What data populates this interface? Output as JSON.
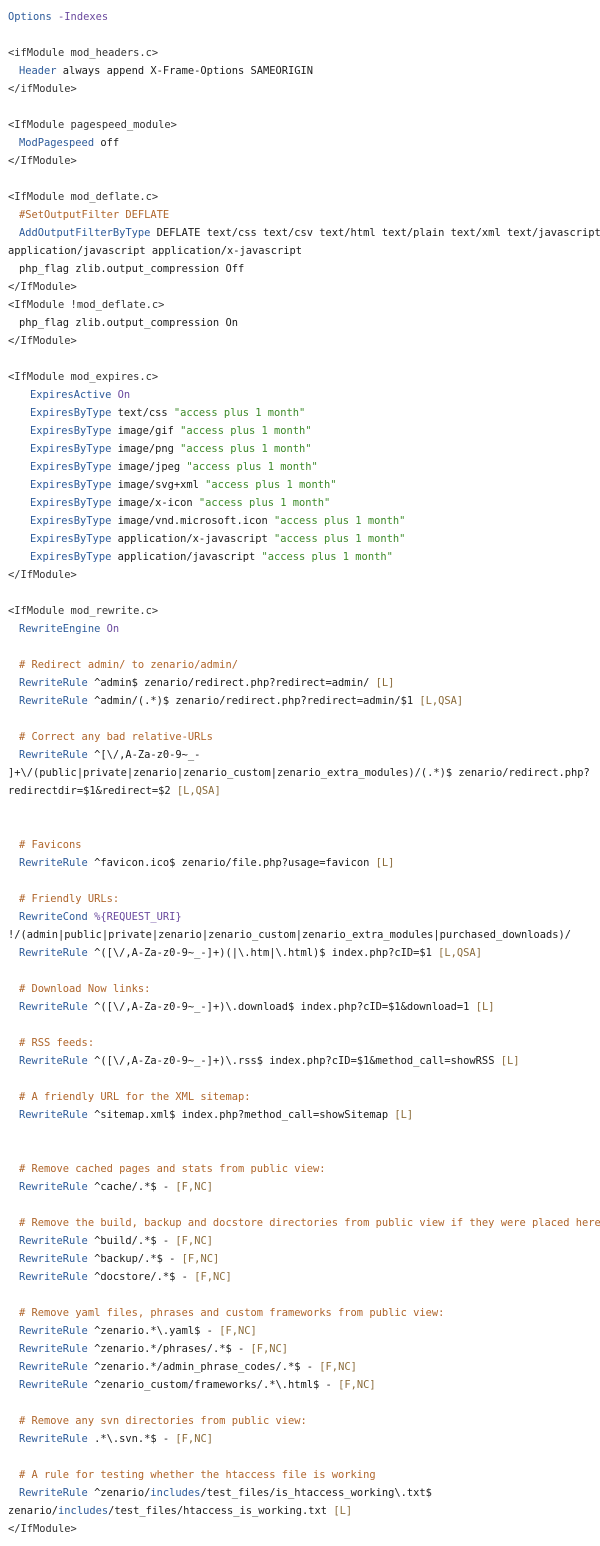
{
  "lines": [
    {
      "indent": 0,
      "parts": [
        [
          "dir",
          "Options "
        ],
        [
          "kw",
          "-Indexes"
        ]
      ]
    },
    {
      "blank": true
    },
    {
      "indent": 0,
      "parts": [
        [
          "tag",
          "<ifModule mod_headers.c>"
        ]
      ]
    },
    {
      "indent": 1,
      "parts": [
        [
          "dir",
          "Header"
        ],
        [
          "val",
          " always append X-Frame-Options SAMEORIGIN"
        ]
      ]
    },
    {
      "indent": 0,
      "parts": [
        [
          "tag",
          "</ifModule>"
        ]
      ]
    },
    {
      "blank": true
    },
    {
      "indent": 0,
      "parts": [
        [
          "tag",
          "<IfModule pagespeed_module>"
        ]
      ]
    },
    {
      "indent": 1,
      "parts": [
        [
          "dir",
          "ModPagespeed"
        ],
        [
          "val",
          " off"
        ]
      ]
    },
    {
      "indent": 0,
      "parts": [
        [
          "tag",
          "</IfModule>"
        ]
      ]
    },
    {
      "blank": true
    },
    {
      "indent": 0,
      "parts": [
        [
          "tag",
          "<IfModule mod_deflate.c>"
        ]
      ]
    },
    {
      "indent": 1,
      "parts": [
        [
          "cmt",
          "#SetOutputFilter DEFLATE"
        ]
      ]
    },
    {
      "indent": 1,
      "parts": [
        [
          "dir",
          "AddOutputFilterByType"
        ],
        [
          "val",
          " DEFLATE text/css text/csv text/html text/plain text/xml text/javascript"
        ]
      ]
    },
    {
      "indent": 0,
      "parts": [
        [
          "val",
          "application/javascript application/x-javascript"
        ]
      ]
    },
    {
      "indent": 1,
      "parts": [
        [
          "val",
          "php_flag zlib.output_compression Off"
        ]
      ]
    },
    {
      "indent": 0,
      "parts": [
        [
          "tag",
          "</IfModule>"
        ]
      ]
    },
    {
      "indent": 0,
      "parts": [
        [
          "tag",
          "<IfModule !mod_deflate.c>"
        ]
      ]
    },
    {
      "indent": 1,
      "parts": [
        [
          "val",
          "php_flag zlib.output_compression On"
        ]
      ]
    },
    {
      "indent": 0,
      "parts": [
        [
          "tag",
          "</IfModule>"
        ]
      ]
    },
    {
      "blank": true
    },
    {
      "indent": 0,
      "parts": [
        [
          "tag",
          "<IfModule mod_expires.c>"
        ]
      ]
    },
    {
      "indent": 2,
      "parts": [
        [
          "dir",
          "ExpiresActive"
        ],
        [
          "kw",
          " On"
        ]
      ]
    },
    {
      "indent": 2,
      "parts": [
        [
          "dir",
          "ExpiresByType"
        ],
        [
          "val",
          " text/css "
        ],
        [
          "str",
          "\"access plus 1 month\""
        ]
      ]
    },
    {
      "indent": 2,
      "parts": [
        [
          "dir",
          "ExpiresByType"
        ],
        [
          "val",
          " image/gif "
        ],
        [
          "str",
          "\"access plus 1 month\""
        ]
      ]
    },
    {
      "indent": 2,
      "parts": [
        [
          "dir",
          "ExpiresByType"
        ],
        [
          "val",
          " image/png "
        ],
        [
          "str",
          "\"access plus 1 month\""
        ]
      ]
    },
    {
      "indent": 2,
      "parts": [
        [
          "dir",
          "ExpiresByType"
        ],
        [
          "val",
          " image/jpeg "
        ],
        [
          "str",
          "\"access plus 1 month\""
        ]
      ]
    },
    {
      "indent": 2,
      "parts": [
        [
          "dir",
          "ExpiresByType"
        ],
        [
          "val",
          " image/svg+xml "
        ],
        [
          "str",
          "\"access plus 1 month\""
        ]
      ]
    },
    {
      "indent": 2,
      "parts": [
        [
          "dir",
          "ExpiresByType"
        ],
        [
          "val",
          " image/x-icon "
        ],
        [
          "str",
          "\"access plus 1 month\""
        ]
      ]
    },
    {
      "indent": 2,
      "parts": [
        [
          "dir",
          "ExpiresByType"
        ],
        [
          "val",
          " image/vnd.microsoft.icon "
        ],
        [
          "str",
          "\"access plus 1 month\""
        ]
      ]
    },
    {
      "indent": 2,
      "parts": [
        [
          "dir",
          "ExpiresByType"
        ],
        [
          "val",
          " application/x-javascript "
        ],
        [
          "str",
          "\"access plus 1 month\""
        ]
      ]
    },
    {
      "indent": 2,
      "parts": [
        [
          "dir",
          "ExpiresByType"
        ],
        [
          "val",
          " application/javascript "
        ],
        [
          "str",
          "\"access plus 1 month\""
        ]
      ]
    },
    {
      "indent": 0,
      "parts": [
        [
          "tag",
          "</IfModule>"
        ]
      ]
    },
    {
      "blank": true
    },
    {
      "indent": 0,
      "parts": [
        [
          "tag",
          "<IfModule mod_rewrite.c>"
        ]
      ]
    },
    {
      "indent": 1,
      "parts": [
        [
          "dir",
          "RewriteEngine"
        ],
        [
          "kw",
          " On"
        ]
      ]
    },
    {
      "blank": true
    },
    {
      "indent": 1,
      "parts": [
        [
          "cmt",
          "# Redirect admin/ to zenario/admin/"
        ]
      ]
    },
    {
      "indent": 1,
      "parts": [
        [
          "dir",
          "RewriteRule"
        ],
        [
          "val",
          " ^admin$ zenario/redirect.php?redirect=admin/ "
        ],
        [
          "flag",
          "[L]"
        ]
      ]
    },
    {
      "indent": 1,
      "parts": [
        [
          "dir",
          "RewriteRule"
        ],
        [
          "val",
          " ^admin/(.*)$ zenario/redirect.php?redirect=admin/$1 "
        ],
        [
          "flag",
          "[L,QSA]"
        ]
      ]
    },
    {
      "blank": true
    },
    {
      "indent": 1,
      "parts": [
        [
          "cmt",
          "# Correct any bad relative-URLs"
        ]
      ]
    },
    {
      "indent": 1,
      "parts": [
        [
          "dir",
          "RewriteRule"
        ],
        [
          "val",
          " ^[\\/,A-Za-z0-9~_-"
        ]
      ]
    },
    {
      "indent": 0,
      "parts": [
        [
          "val",
          "]+\\/(public|private|zenario|zenario_custom|zenario_extra_modules)/(.*)$ zenario/redirect.php?"
        ]
      ]
    },
    {
      "indent": 0,
      "parts": [
        [
          "val",
          "redirectdir=$1&redirect=$2 "
        ],
        [
          "flag",
          "[L,QSA]"
        ]
      ]
    },
    {
      "blank": true
    },
    {
      "blank": true
    },
    {
      "indent": 1,
      "parts": [
        [
          "cmt",
          "# Favicons"
        ]
      ]
    },
    {
      "indent": 1,
      "parts": [
        [
          "dir",
          "RewriteRule"
        ],
        [
          "val",
          " ^favicon.ico$ zenario/file.php?usage=favicon "
        ],
        [
          "flag",
          "[L]"
        ]
      ]
    },
    {
      "blank": true
    },
    {
      "indent": 1,
      "parts": [
        [
          "cmt",
          "# Friendly URLs:"
        ]
      ]
    },
    {
      "indent": 1,
      "parts": [
        [
          "dir",
          "RewriteCond"
        ],
        [
          "kw",
          " %{REQUEST_URI}"
        ]
      ]
    },
    {
      "indent": 0,
      "parts": [
        [
          "val",
          "!/(admin|public|private|zenario|zenario_custom|zenario_extra_modules|purchased_downloads)/"
        ]
      ]
    },
    {
      "indent": 1,
      "parts": [
        [
          "dir",
          "RewriteRule"
        ],
        [
          "val",
          " ^([\\/,A-Za-z0-9~_-]+)(|\\.htm|\\.html)$ index.php?cID=$1 "
        ],
        [
          "flag",
          "[L,QSA]"
        ]
      ]
    },
    {
      "blank": true
    },
    {
      "indent": 1,
      "parts": [
        [
          "cmt",
          "# Download Now links:"
        ]
      ]
    },
    {
      "indent": 1,
      "parts": [
        [
          "dir",
          "RewriteRule"
        ],
        [
          "val",
          " ^([\\/,A-Za-z0-9~_-]+)\\.download$ index.php?cID=$1&download=1 "
        ],
        [
          "flag",
          "[L]"
        ]
      ]
    },
    {
      "blank": true
    },
    {
      "indent": 1,
      "parts": [
        [
          "cmt",
          "# RSS feeds:"
        ]
      ]
    },
    {
      "indent": 1,
      "parts": [
        [
          "dir",
          "RewriteRule"
        ],
        [
          "val",
          " ^([\\/,A-Za-z0-9~_-]+)\\.rss$ index.php?cID=$1&method_call=showRSS "
        ],
        [
          "flag",
          "[L]"
        ]
      ]
    },
    {
      "blank": true
    },
    {
      "indent": 1,
      "parts": [
        [
          "cmt",
          "# A friendly URL for the XML sitemap:"
        ]
      ]
    },
    {
      "indent": 1,
      "parts": [
        [
          "dir",
          "RewriteRule"
        ],
        [
          "val",
          " ^sitemap.xml$ index.php?method_call=showSitemap "
        ],
        [
          "flag",
          "[L]"
        ]
      ]
    },
    {
      "blank": true
    },
    {
      "blank": true
    },
    {
      "indent": 1,
      "parts": [
        [
          "cmt",
          "# Remove cached pages and stats from public view:"
        ]
      ]
    },
    {
      "indent": 1,
      "parts": [
        [
          "dir",
          "RewriteRule"
        ],
        [
          "val",
          " ^cache/.*$ - "
        ],
        [
          "flag",
          "[F,NC]"
        ]
      ]
    },
    {
      "blank": true
    },
    {
      "indent": 1,
      "parts": [
        [
          "cmt",
          "# Remove the build, backup and docstore directories from public view if they were placed here:"
        ]
      ]
    },
    {
      "indent": 1,
      "parts": [
        [
          "dir",
          "RewriteRule"
        ],
        [
          "val",
          " ^build/.*$ - "
        ],
        [
          "flag",
          "[F,NC]"
        ]
      ]
    },
    {
      "indent": 1,
      "parts": [
        [
          "dir",
          "RewriteRule"
        ],
        [
          "val",
          " ^backup/.*$ - "
        ],
        [
          "flag",
          "[F,NC]"
        ]
      ]
    },
    {
      "indent": 1,
      "parts": [
        [
          "dir",
          "RewriteRule"
        ],
        [
          "val",
          " ^docstore/.*$ - "
        ],
        [
          "flag",
          "[F,NC]"
        ]
      ]
    },
    {
      "blank": true
    },
    {
      "indent": 1,
      "parts": [
        [
          "cmt",
          "# Remove yaml files, phrases and custom frameworks from public view:"
        ]
      ]
    },
    {
      "indent": 1,
      "parts": [
        [
          "dir",
          "RewriteRule"
        ],
        [
          "val",
          " ^zenario.*\\.yaml$ - "
        ],
        [
          "flag",
          "[F,NC]"
        ]
      ]
    },
    {
      "indent": 1,
      "parts": [
        [
          "dir",
          "RewriteRule"
        ],
        [
          "val",
          " ^zenario.*/phrases/.*$ - "
        ],
        [
          "flag",
          "[F,NC]"
        ]
      ]
    },
    {
      "indent": 1,
      "parts": [
        [
          "dir",
          "RewriteRule"
        ],
        [
          "val",
          " ^zenario.*/admin_phrase_codes/.*$ - "
        ],
        [
          "flag",
          "[F,NC]"
        ]
      ]
    },
    {
      "indent": 1,
      "parts": [
        [
          "dir",
          "RewriteRule"
        ],
        [
          "val",
          " ^zenario_custom/frameworks/.*\\.html$ - "
        ],
        [
          "flag",
          "[F,NC]"
        ]
      ]
    },
    {
      "blank": true
    },
    {
      "indent": 1,
      "parts": [
        [
          "cmt",
          "# Remove any svn directories from public view:"
        ]
      ]
    },
    {
      "indent": 1,
      "parts": [
        [
          "dir",
          "RewriteRule"
        ],
        [
          "val",
          " .*\\.svn.*$ - "
        ],
        [
          "flag",
          "[F,NC]"
        ]
      ]
    },
    {
      "blank": true
    },
    {
      "indent": 1,
      "parts": [
        [
          "cmt",
          "# A rule for testing whether the htaccess file is working"
        ]
      ]
    },
    {
      "indent": 1,
      "parts": [
        [
          "dir",
          "RewriteRule"
        ],
        [
          "val",
          " ^zenario/"
        ],
        [
          "dir",
          "includes"
        ],
        [
          "val",
          "/test_files/is_htaccess_working\\.txt$"
        ]
      ]
    },
    {
      "indent": 0,
      "parts": [
        [
          "val",
          "zenario/"
        ],
        [
          "dir",
          "includes"
        ],
        [
          "val",
          "/test_files/htaccess_is_working.txt "
        ],
        [
          "flag",
          "[L]"
        ]
      ]
    },
    {
      "indent": 0,
      "parts": [
        [
          "tag",
          "</IfModule>"
        ]
      ]
    }
  ]
}
